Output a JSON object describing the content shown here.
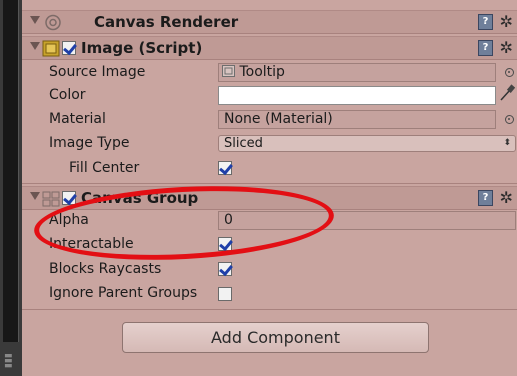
{
  "canvas_renderer": {
    "title": "Canvas Renderer"
  },
  "image_script": {
    "title": "Image (Script)",
    "enabled": true,
    "rows": {
      "source_image": {
        "label": "Source Image",
        "value": "Tooltip"
      },
      "color": {
        "label": "Color",
        "value": "#ffffff"
      },
      "material": {
        "label": "Material",
        "value": "None (Material)"
      },
      "image_type": {
        "label": "Image Type",
        "value": "Sliced"
      },
      "fill_center": {
        "label": "Fill Center",
        "checked": true
      }
    }
  },
  "canvas_group": {
    "title": "Canvas Group",
    "enabled": true,
    "rows": {
      "alpha": {
        "label": "Alpha",
        "value": "0"
      },
      "interactable": {
        "label": "Interactable",
        "checked": true
      },
      "blocks_raycasts": {
        "label": "Blocks Raycasts",
        "checked": true
      },
      "ignore_parent_groups": {
        "label": "Ignore Parent Groups",
        "checked": false
      }
    }
  },
  "add_component": {
    "label": "Add Component"
  },
  "annotation": {
    "color": "#e30f14"
  }
}
